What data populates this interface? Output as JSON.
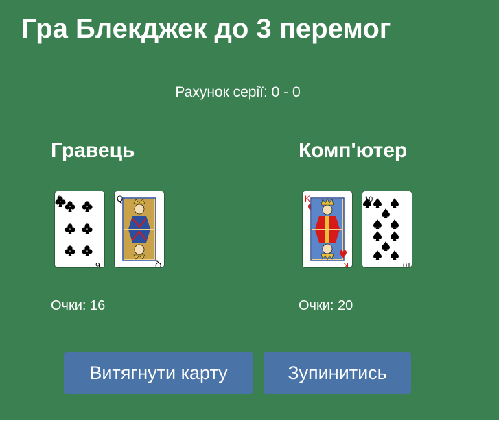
{
  "game": {
    "title": "Гра Блекджек до 3 перемог",
    "series_score": "Рахунок серії: 0 - 0"
  },
  "player": {
    "title": "Гравець",
    "points": "Очки: 16",
    "cards": [
      {
        "rank": "6",
        "suit": "clubs",
        "color": "#000000"
      },
      {
        "rank": "Q",
        "suit": "clubs",
        "color": "#000000"
      }
    ]
  },
  "computer": {
    "title": "Комп'ютер",
    "points": "Очки: 20",
    "cards": [
      {
        "rank": "K",
        "suit": "hearts",
        "color": "#d61a1a"
      },
      {
        "rank": "10",
        "suit": "spades",
        "color": "#000000"
      }
    ]
  },
  "controls": {
    "draw_label": "Витягнути карту",
    "stand_label": "Зупинитись"
  },
  "colors": {
    "table": "#3a8050",
    "button": "#4a74a8",
    "text": "#ffffff"
  }
}
